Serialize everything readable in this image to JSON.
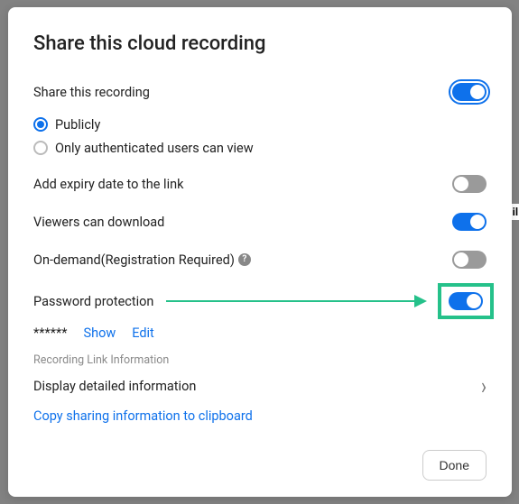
{
  "title": "Share this cloud recording",
  "rows": {
    "share": {
      "label": "Share this recording"
    },
    "radio_publicly": "Publicly",
    "radio_auth": "Only authenticated users can view",
    "expiry": {
      "label": "Add expiry date to the link"
    },
    "download": {
      "label": "Viewers can download"
    },
    "ondemand": {
      "label": "On-demand(Registration Required)"
    },
    "ondemand_help": "?",
    "password": {
      "label": "Password protection"
    }
  },
  "password_area": {
    "masked": "******",
    "show": "Show",
    "edit": "Edit"
  },
  "section_label": "Recording Link Information",
  "detail_row": "Display detailed information",
  "copy_link": "Copy sharing information to clipboard",
  "done": "Done",
  "behind": "il"
}
